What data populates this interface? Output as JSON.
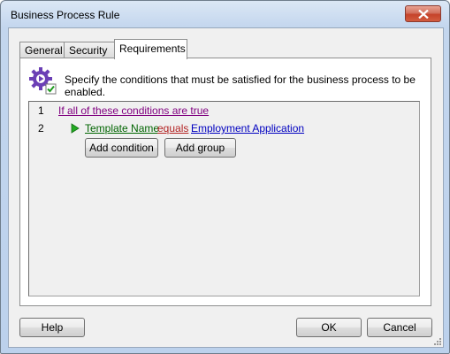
{
  "window": {
    "title": "Business Process Rule"
  },
  "tabs": [
    {
      "label": "General"
    },
    {
      "label": "Security"
    },
    {
      "label": "Requirements"
    }
  ],
  "panel": {
    "description": "Specify the conditions that must be satisfied for the business process to be enabled."
  },
  "editor": {
    "lines": [
      {
        "number": "1",
        "group_text": "If all of these conditions are true"
      },
      {
        "number": "2",
        "field": "Template Name",
        "operator": "equals",
        "value": "Employment Application"
      }
    ],
    "add_condition_label": "Add condition",
    "add_group_label": "Add group"
  },
  "footer": {
    "help_label": "Help",
    "ok_label": "OK",
    "cancel_label": "Cancel"
  },
  "colors": {
    "group_link": "#800080",
    "field_link": "#006400",
    "operator_link": "#b22222",
    "value_link": "#0000c0",
    "play_icon": "#22aa22"
  },
  "icons": [
    "business-process-gear-icon",
    "play-icon",
    "close-icon",
    "resize-grip-icon"
  ]
}
